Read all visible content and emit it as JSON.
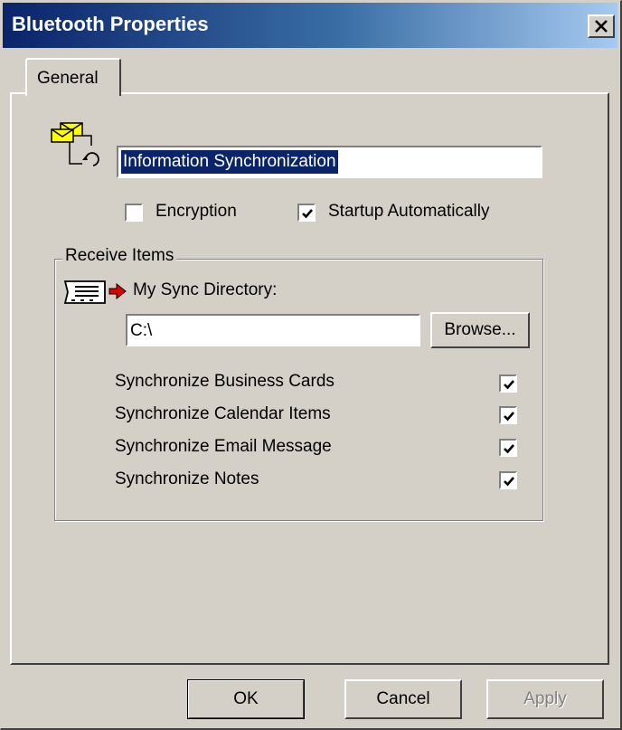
{
  "window": {
    "title": "Bluetooth Properties",
    "close_label": "×"
  },
  "tabs": [
    {
      "label": "General",
      "active": true
    }
  ],
  "service": {
    "icon": "sync-envelope-icon",
    "name": "Information Synchronization"
  },
  "options": {
    "encryption": {
      "label": "Encryption",
      "checked": false
    },
    "startup": {
      "label": "Startup Automatically",
      "checked": true
    }
  },
  "receive_items": {
    "legend": "Receive Items",
    "directory_label": "My Sync Directory:",
    "directory_value": "C:\\",
    "browse_label": "Browse...",
    "items": [
      {
        "label": "Synchronize Business Cards",
        "checked": true
      },
      {
        "label": "Synchronize Calendar Items",
        "checked": true
      },
      {
        "label": "Synchronize Email Message",
        "checked": true
      },
      {
        "label": "Synchronize Notes",
        "checked": true
      }
    ]
  },
  "buttons": {
    "ok": "OK",
    "cancel": "Cancel",
    "apply": "Apply"
  },
  "colors": {
    "face": "#d4d0c8",
    "title_start": "#0a246a",
    "title_end": "#a6caf0",
    "selection": "#0a246a",
    "arrow": "#e00000",
    "envelope": "#ffff00"
  }
}
